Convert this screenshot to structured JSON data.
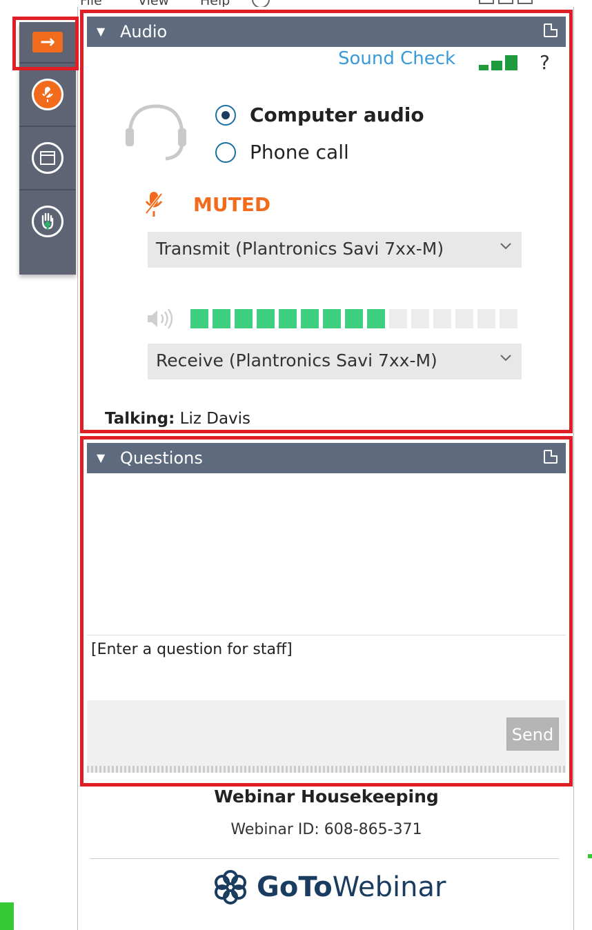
{
  "menu": {
    "file": "File",
    "view": "View",
    "help": "Help"
  },
  "audio_panel": {
    "title": "Audio",
    "sound_check": "Sound Check",
    "help": "?",
    "options": [
      {
        "label": "Computer audio",
        "selected": true
      },
      {
        "label": "Phone call",
        "selected": false
      }
    ],
    "mute_status": "MUTED",
    "transmit_device": "Transmit (Plantronics Savi 7xx-M)",
    "receive_device": "Receive (Plantronics Savi 7xx-M)",
    "speaker_level": {
      "filled": 9,
      "total": 15
    },
    "talking_label": "Talking:",
    "talking_name": "Liz Davis"
  },
  "questions_panel": {
    "title": "Questions",
    "input_placeholder": "[Enter a question for staff]",
    "send_label": "Send"
  },
  "footer": {
    "title": "Webinar Housekeeping",
    "webinar_id": "Webinar ID: 608-865-371",
    "logo_bold": "GoTo",
    "logo_regular": "Webinar"
  },
  "colors": {
    "accent_orange": "#f26b1d",
    "header_bg": "#5e6a7e",
    "highlight_red": "#e01e25",
    "level_green": "#3ed07f",
    "link_blue": "#3a9ad9"
  }
}
